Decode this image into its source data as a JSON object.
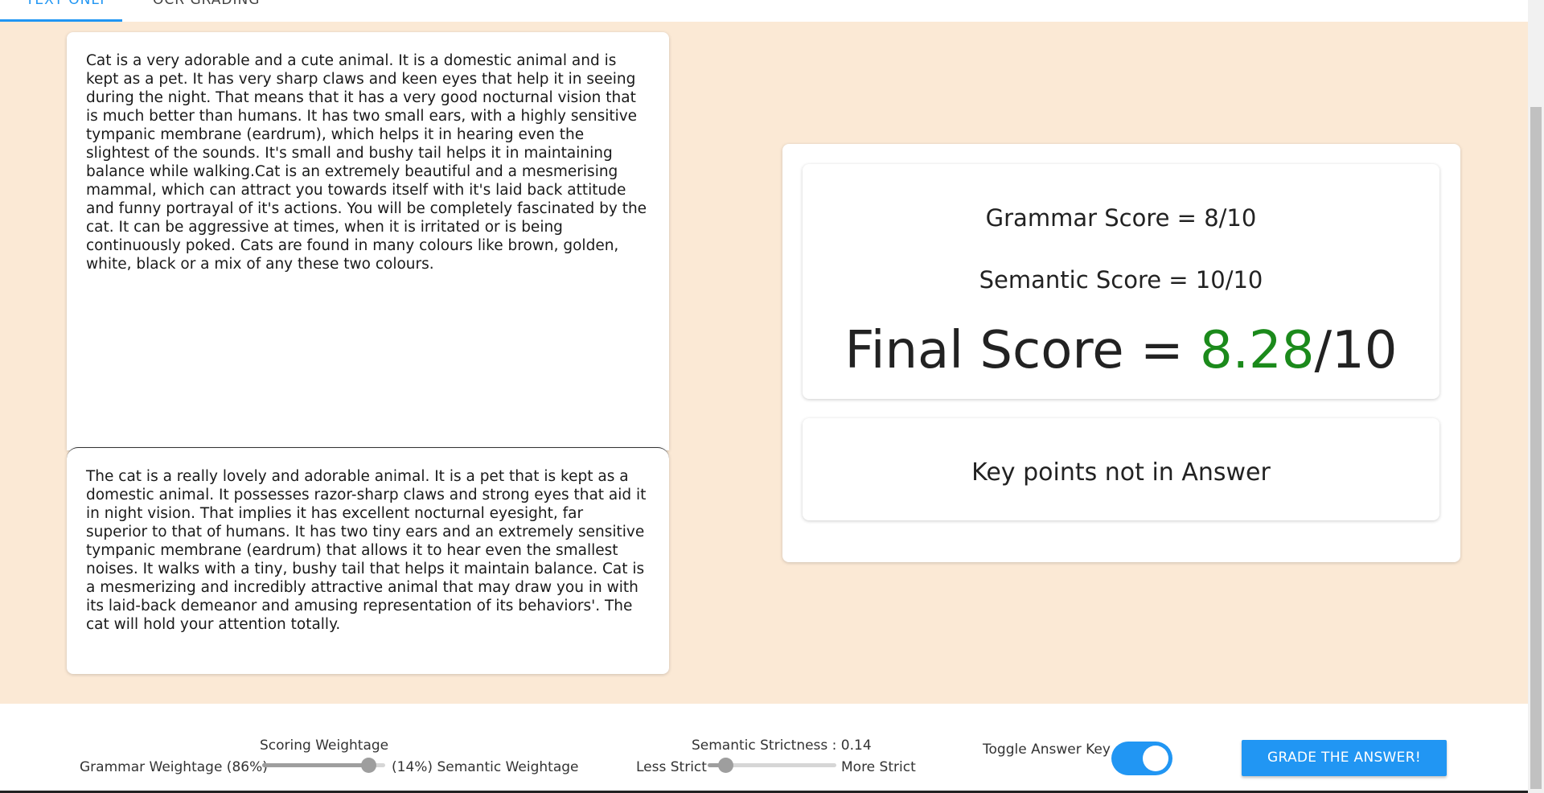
{
  "tabs": [
    {
      "label": "TEXT ONLY"
    },
    {
      "label": "OCR GRADING"
    }
  ],
  "answer_key_text": "Cat is a very adorable and a cute animal. It is a domestic animal and is kept as a pet. It has very sharp claws and keen eyes that help it in seeing during the night. That means that it has a very good nocturnal vision that is much better than humans. It has two small ears, with a highly sensitive tympanic membrane (eardrum), which helps it in hearing even the slightest of the sounds. It's small and bushy tail helps it in maintaining balance while walking.Cat is an extremely beautiful and a mesmerising mammal, which can attract you towards itself with it's laid back attitude and funny portrayal of it's actions. You will be completely fascinated by the cat. It can be aggressive at times, when it is irritated or is being continuously poked. Cats are found in many colours like brown, golden, white, black or a mix of any these two colours.",
  "student_answer_text": "The cat is a really lovely and adorable animal. It is a pet that is kept as a domestic animal. It possesses razor-sharp claws and strong eyes that aid it in night vision. That implies it has excellent nocturnal eyesight, far superior to that of humans. It has two tiny ears and an extremely sensitive tympanic membrane (eardrum) that allows it to hear even the smallest noises. It walks with a tiny, bushy tail that helps it maintain balance. Cat is a mesmerizing and incredibly attractive animal that may draw you in with its laid-back demeanor and amusing representation of its behaviors'. The cat will hold your attention totally.",
  "scores": {
    "grammar_label": "Grammar Score = 8/10",
    "semantic_label": "Semantic Score = 10/10",
    "final_prefix": "Final Score = ",
    "final_value": "8.28",
    "final_suffix": "/10"
  },
  "key_points_title": "Key points not in Answer",
  "footer": {
    "scoring_title": "Scoring Weightage",
    "grammar_weight_label": "Grammar Weightage (86%)",
    "semantic_weight_label": "(14%) Semantic Weightage",
    "scoring_slider_fraction": 0.86,
    "strictness_title": "Semantic Strictness : 0.14",
    "less_strict_label": "Less Strict",
    "more_strict_label": "More Strict",
    "strictness_slider_fraction": 0.14,
    "toggle_label": "Toggle Answer Key",
    "toggle_on": true,
    "grade_button_label": "GRADE THE ANSWER!"
  },
  "colors": {
    "accent": "#2196f3",
    "background": "#fbe9d5",
    "final_score": "#1b8a1b"
  }
}
